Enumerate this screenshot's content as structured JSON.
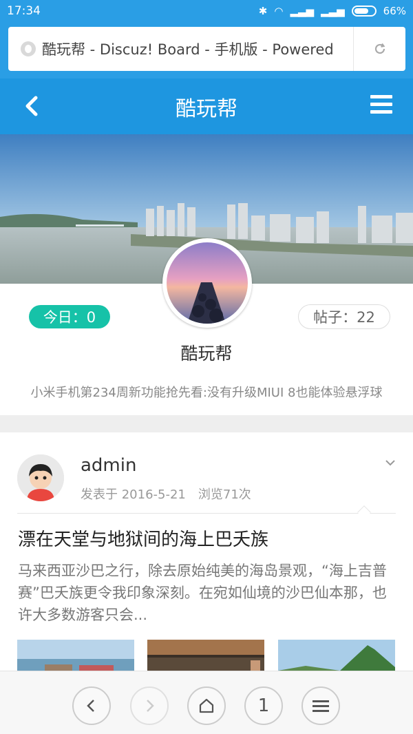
{
  "status_bar": {
    "time": "17:34",
    "battery": "66%"
  },
  "browser": {
    "url": "酷玩帮 - Discuz! Board - 手机版 - Powered"
  },
  "header": {
    "title": "酷玩帮"
  },
  "forum": {
    "today_label": "今日：0",
    "posts_label": "帖子：22",
    "name": "酷玩帮",
    "description": "小米手机第234周新功能抢先看:没有升级MIUI 8也能体验悬浮球"
  },
  "post": {
    "author": "admin",
    "meta": "发表于 2016-5-21　浏览71次",
    "title": "漂在天堂与地狱间的海上巴夭族",
    "excerpt": "马来西亚沙巴之行，除去原始纯美的海岛景观，“海上吉普赛”巴夭族更令我印象深刻。在宛如仙境的沙巴仙本那，也许大多数游客只会..."
  },
  "bottom_nav": {
    "page_number": "1"
  },
  "colors": {
    "accent": "#1e96e0",
    "status": "#2a9ee5",
    "badge": "#16c2a8"
  }
}
